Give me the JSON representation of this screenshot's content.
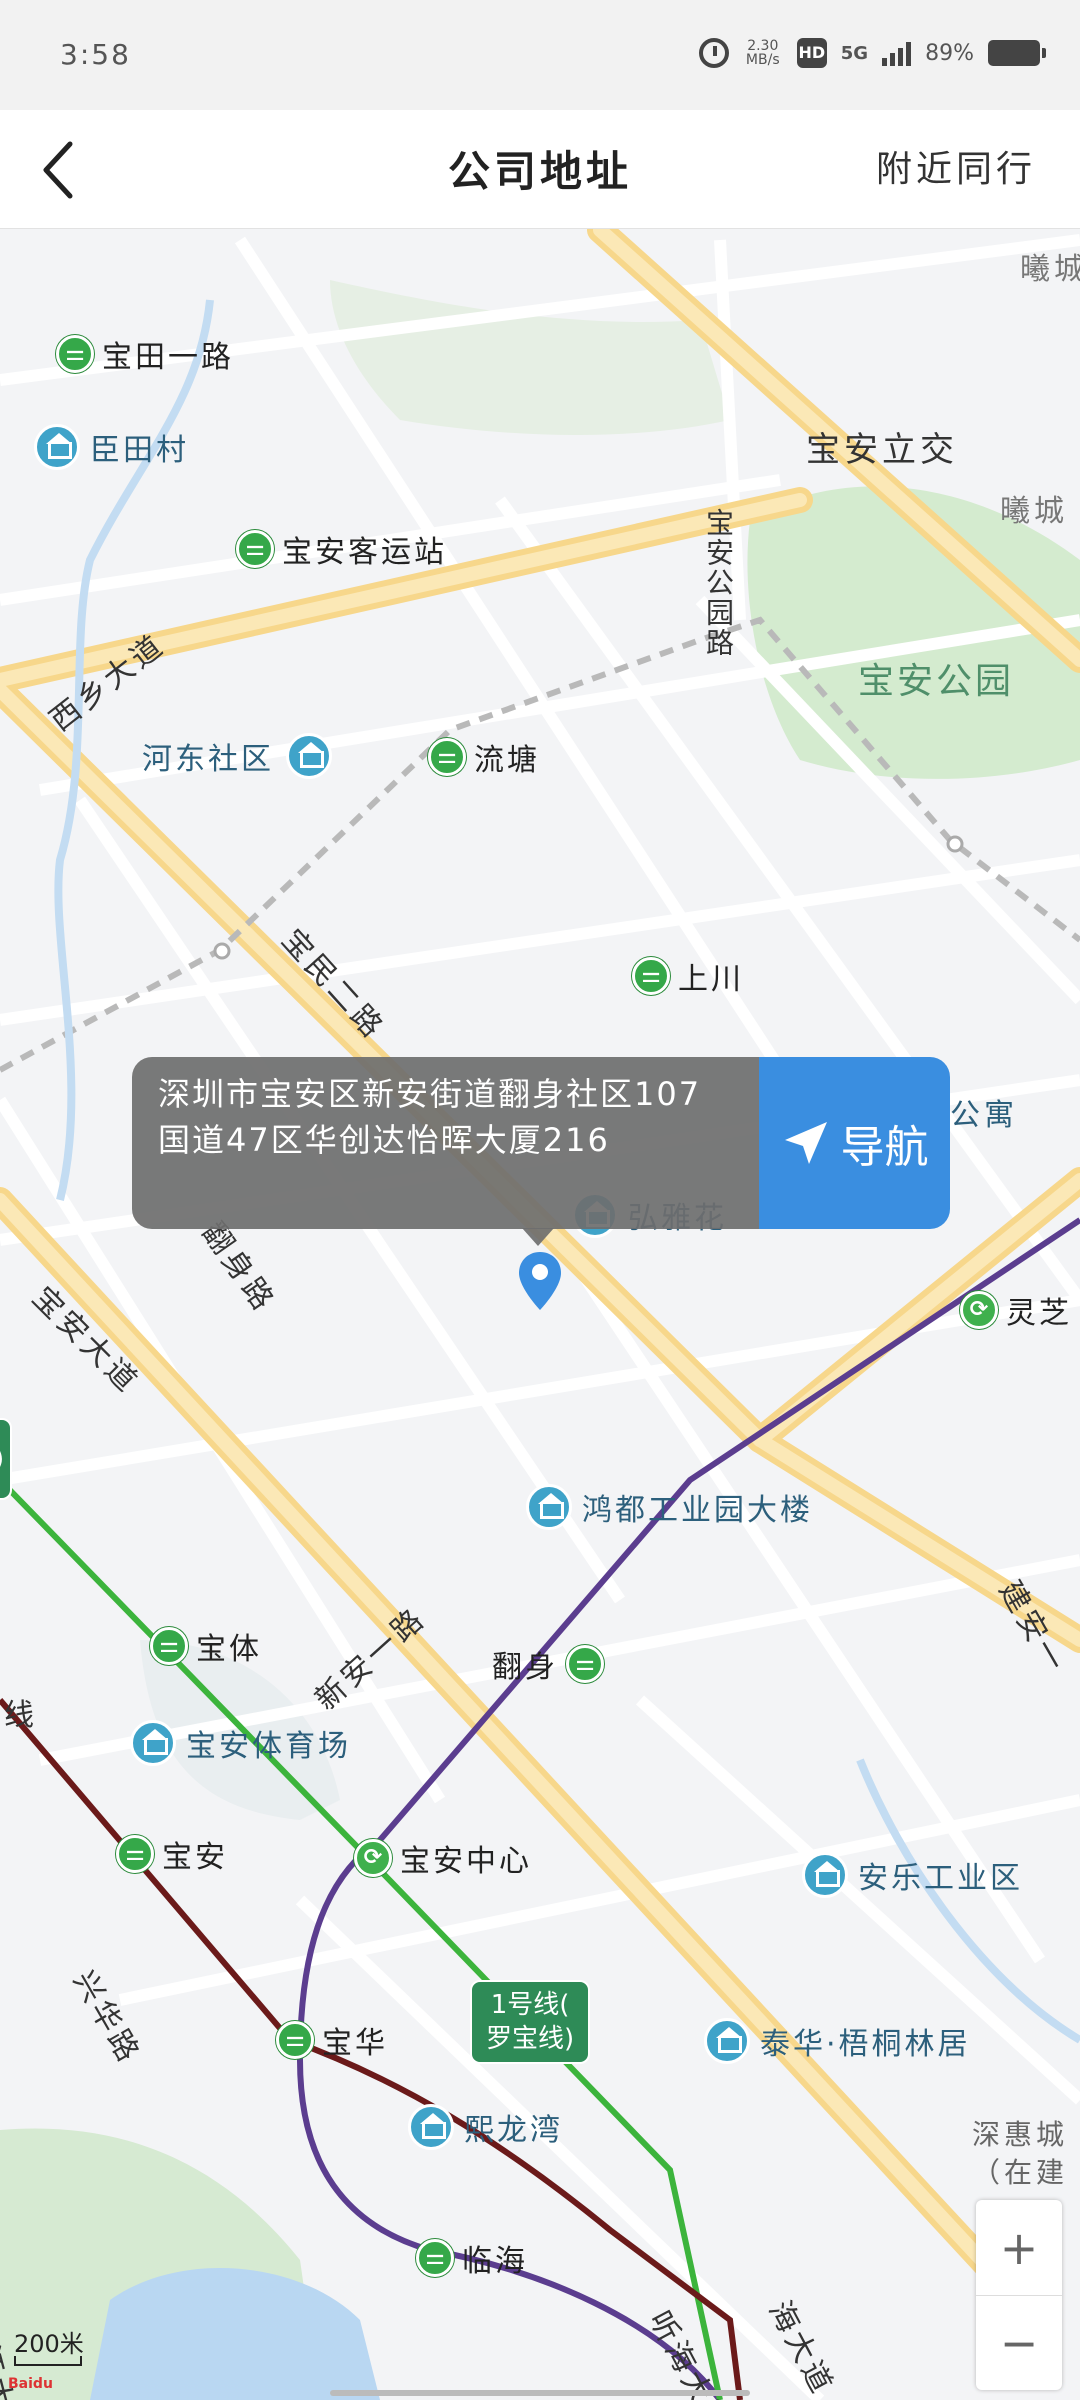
{
  "status_bar": {
    "time": "3:58",
    "network_speed": "2.30 MB/s",
    "hd": "HD",
    "signal": "5G",
    "battery": "89%"
  },
  "nav": {
    "title": "公司地址",
    "right_action": "附近同行"
  },
  "map": {
    "labels": {
      "baotian_road": "宝田一路",
      "chentian_village": "臣田村",
      "baoan_bus_station": "宝安客运站",
      "xixiang_avenue": "西乡大道",
      "hedong_community": "河东社区",
      "liutang": "流塘",
      "baoan_interchange": "宝安立交",
      "baoan_park_road": "宝安公园路",
      "baoan_park": "宝安公园",
      "xicheng_top": "曦城",
      "xicheng_right": "曦城",
      "baomin_road": "宝民二路",
      "shangchuan": "上川",
      "apartment_fragment": "公寓",
      "hongya_garden": "弘雅花",
      "fanshen_road": "翻身路",
      "lingzhi": "灵芝",
      "baoan_avenue": "宝安大道",
      "hongdu_building": "鸿都工业园大楼",
      "jianan_road": "建安一",
      "xinan_road": "新安一路",
      "fanshen_station": "翻身",
      "baoti": "宝体",
      "baoan_stadium": "宝安体育场",
      "baoan_station": "宝安",
      "baoan_center": "宝安中心",
      "anle_industrial": "安乐工业区",
      "xinghua_road": "兴华路",
      "baohua": "宝华",
      "line1_badge": "1号线(\n罗宝线)",
      "taihua_residence": "泰华·梧桐林居",
      "xilongwan": "熙龙湾",
      "shenhuicheng": "深惠城\n（在建",
      "linhai": "临海",
      "tinghai_avenue": "听海大道",
      "yonghai_avenue": "海大道",
      "left_line_fragment": "线",
      "bottom_left_fragment": "宝江大",
      "left_badge_fragment": ")"
    },
    "address_text": "深圳市宝安区新安街道翻身社区107国道47区华创达怡晖大厦216",
    "navigate_label": "导航",
    "zoom_in": "+",
    "zoom_out": "−",
    "scale": "200米",
    "logo": "Baidu"
  },
  "colors": {
    "accent_blue": "#3a8ee0",
    "metro_green": "#35a849",
    "major_road": "#fbe3a6",
    "park": "#cfe8c7",
    "line_purple": "#5b3d8f",
    "line_maroon": "#6b1a1a"
  }
}
